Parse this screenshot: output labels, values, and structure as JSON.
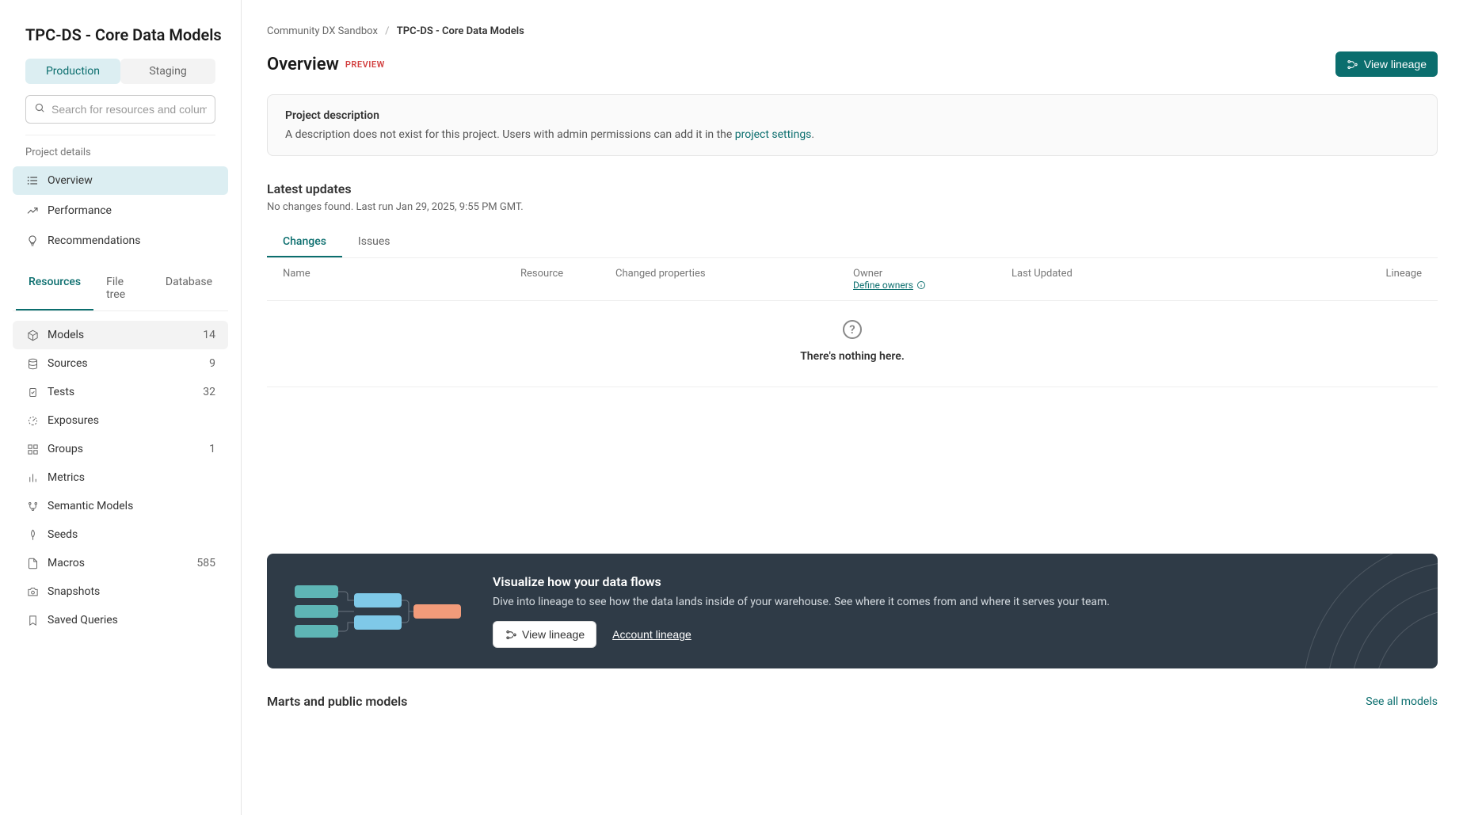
{
  "sidebar": {
    "title": "TPC-DS - Core Data Models",
    "env_tabs": {
      "production": "Production",
      "staging": "Staging"
    },
    "search_placeholder": "Search for resources and columns",
    "project_details_label": "Project details",
    "nav": {
      "overview": "Overview",
      "performance": "Performance",
      "recommendations": "Recommendations"
    },
    "sub_tabs": {
      "resources": "Resources",
      "file_tree": "File tree",
      "database": "Database"
    },
    "resources": [
      {
        "label": "Models",
        "count": "14"
      },
      {
        "label": "Sources",
        "count": "9"
      },
      {
        "label": "Tests",
        "count": "32"
      },
      {
        "label": "Exposures",
        "count": ""
      },
      {
        "label": "Groups",
        "count": "1"
      },
      {
        "label": "Metrics",
        "count": ""
      },
      {
        "label": "Semantic Models",
        "count": ""
      },
      {
        "label": "Seeds",
        "count": ""
      },
      {
        "label": "Macros",
        "count": "585"
      },
      {
        "label": "Snapshots",
        "count": ""
      },
      {
        "label": "Saved Queries",
        "count": ""
      }
    ]
  },
  "breadcrumb": {
    "root": "Community DX Sandbox",
    "current": "TPC-DS - Core Data Models"
  },
  "page": {
    "title": "Overview",
    "preview_badge": "PREVIEW",
    "view_lineage_btn": "View lineage"
  },
  "desc_card": {
    "title": "Project description",
    "text_before": "A description does not exist for this project. Users with admin permissions can add it in the ",
    "link": "project settings",
    "text_after": "."
  },
  "updates": {
    "title": "Latest updates",
    "subtitle": "No changes found. Last run Jan 29, 2025, 9:55 PM GMT.",
    "tabs": {
      "changes": "Changes",
      "issues": "Issues"
    },
    "columns": {
      "name": "Name",
      "resource": "Resource",
      "changed_props": "Changed properties",
      "owner": "Owner",
      "define_owners": "Define owners",
      "last_updated": "Last Updated",
      "lineage": "Lineage"
    },
    "empty": "There's nothing here."
  },
  "banner": {
    "title": "Visualize how your data flows",
    "text": "Dive into lineage to see how the data lands inside of your warehouse. See where it comes from and where it serves your team.",
    "view_lineage": "View lineage",
    "account_lineage": "Account lineage"
  },
  "bottom": {
    "title": "Marts and public models",
    "see_all": "See all models"
  }
}
